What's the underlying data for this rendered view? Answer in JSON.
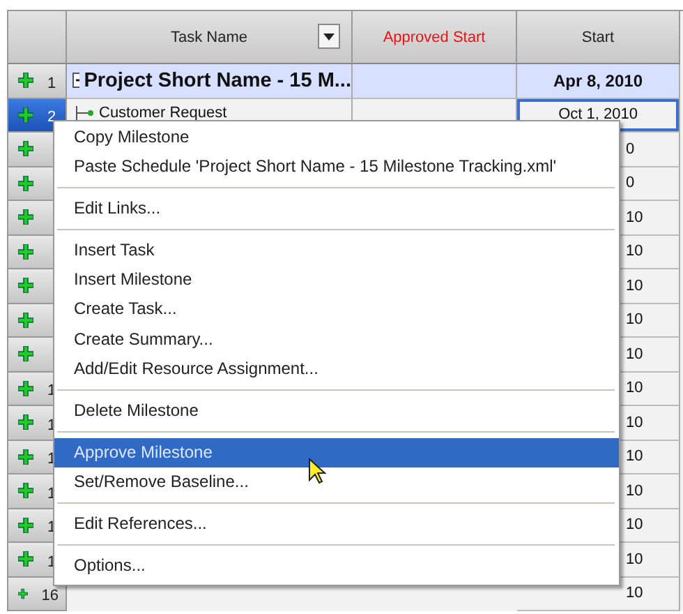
{
  "table": {
    "columns": [
      {
        "label": "Task Name",
        "kind": "filter",
        "color": "#222222"
      },
      {
        "label": "Approved Start",
        "kind": "plain",
        "color": "#ee1111"
      },
      {
        "label": "Start",
        "kind": "plain",
        "color": "#222222"
      }
    ],
    "rows": [
      {
        "number": "1",
        "kind": "summary",
        "expanded": true,
        "task": "Project Short Name - 15 M...",
        "start": "Apr 8, 2010",
        "selected": false
      },
      {
        "number": "2",
        "kind": "milestone",
        "task": "Customer Request",
        "start": "Oct 1, 2010",
        "selected": true
      },
      {
        "kind": "covered",
        "start": "0",
        "selected": false
      },
      {
        "kind": "covered",
        "start": "0",
        "selected": false
      },
      {
        "kind": "covered",
        "start": "10",
        "selected": false
      },
      {
        "kind": "covered",
        "start": "10",
        "selected": false
      },
      {
        "kind": "covered",
        "start": "10",
        "selected": false
      },
      {
        "kind": "covered",
        "start": "10",
        "selected": false
      },
      {
        "kind": "covered",
        "start": "10",
        "selected": false
      },
      {
        "number": "1",
        "kind": "covered",
        "start": "10",
        "selected": false
      },
      {
        "number": "1",
        "kind": "covered",
        "start": "10",
        "selected": false
      },
      {
        "number": "1",
        "kind": "covered",
        "start": "10",
        "selected": false
      },
      {
        "number": "1",
        "kind": "covered",
        "start": "10",
        "selected": false
      },
      {
        "number": "1",
        "kind": "covered",
        "start": "10",
        "selected": false
      },
      {
        "number": "1",
        "kind": "covered",
        "start": "10",
        "selected": false
      },
      {
        "number": "16",
        "kind": "covered",
        "start": "10",
        "selected": false
      }
    ]
  },
  "context_menu": {
    "items": [
      {
        "kind": "item",
        "label": "Copy Milestone",
        "selected": false
      },
      {
        "kind": "item",
        "label": "Paste Schedule 'Project Short Name - 15 Milestone Tracking.xml'",
        "selected": false
      },
      {
        "kind": "separator"
      },
      {
        "kind": "item",
        "label": "Edit Links...",
        "selected": false
      },
      {
        "kind": "separator"
      },
      {
        "kind": "item",
        "label": "Insert Task",
        "selected": false
      },
      {
        "kind": "item",
        "label": "Insert Milestone",
        "selected": false
      },
      {
        "kind": "item",
        "label": "Create Task...",
        "selected": false
      },
      {
        "kind": "item",
        "label": "Create Summary...",
        "selected": false
      },
      {
        "kind": "item",
        "label": "Add/Edit Resource Assignment...",
        "selected": false
      },
      {
        "kind": "separator"
      },
      {
        "kind": "item",
        "label": "Delete Milestone",
        "selected": false
      },
      {
        "kind": "separator"
      },
      {
        "kind": "item",
        "label": "Approve Milestone",
        "selected": true
      },
      {
        "kind": "item",
        "label": "Set/Remove Baseline...",
        "selected": false
      },
      {
        "kind": "separator"
      },
      {
        "kind": "item",
        "label": "Edit References...",
        "selected": false
      },
      {
        "kind": "separator"
      },
      {
        "kind": "item",
        "label": "Options...",
        "selected": false
      }
    ]
  }
}
